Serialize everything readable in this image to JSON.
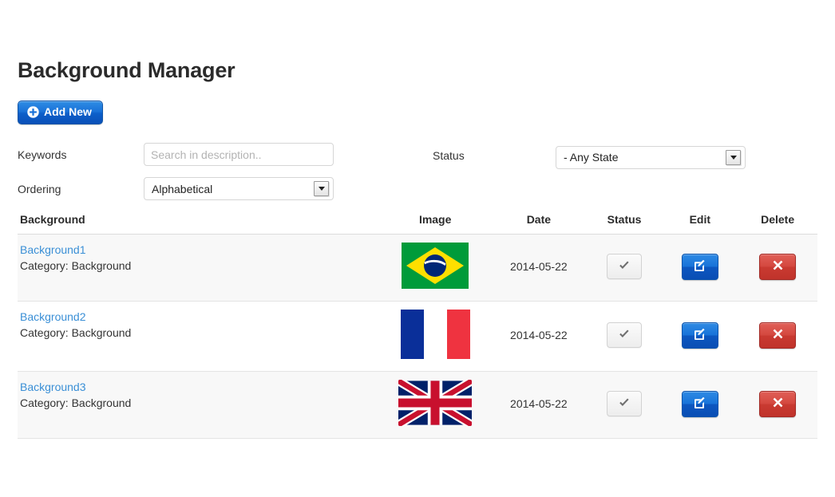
{
  "header": {
    "title": "Background Manager"
  },
  "toolbar": {
    "add_new_label": "Add New",
    "add_new_icon": "plus-circle-icon",
    "add_new_color": "#1a72d8"
  },
  "filters": {
    "keywords_label": "Keywords",
    "keywords_placeholder": "Search in description..",
    "keywords_value": "",
    "ordering_label": "Ordering",
    "ordering_value": "Alphabetical",
    "status_label": "Status",
    "status_value": "- Any State"
  },
  "table": {
    "columns": [
      {
        "key": "background",
        "label": "Background"
      },
      {
        "key": "image",
        "label": "Image"
      },
      {
        "key": "date",
        "label": "Date"
      },
      {
        "key": "status",
        "label": "Status"
      },
      {
        "key": "edit",
        "label": "Edit"
      },
      {
        "key": "delete",
        "label": "Delete"
      }
    ],
    "rows": [
      {
        "name": "Background1",
        "category": "Category: Background",
        "flag": "brazil-flag",
        "date": "2014-05-22",
        "status_icon": "check-icon",
        "edit_icon": "pencil-square-icon",
        "delete_icon": "cross-icon",
        "striped": true
      },
      {
        "name": "Background2",
        "category": "Category: Background",
        "flag": "france-flag",
        "date": "2014-05-22",
        "status_icon": "check-icon",
        "edit_icon": "pencil-square-icon",
        "delete_icon": "cross-icon",
        "striped": false
      },
      {
        "name": "Background3",
        "category": "Category: Background",
        "flag": "uk-flag",
        "date": "2014-05-22",
        "status_icon": "check-icon",
        "edit_icon": "pencil-square-icon",
        "delete_icon": "cross-icon",
        "striped": true
      }
    ]
  },
  "colors": {
    "link": "#3a8fd6",
    "primary_blue": "#1a72d8",
    "danger_red": "#c93a31",
    "row_stripe": "#f8f8f8"
  }
}
